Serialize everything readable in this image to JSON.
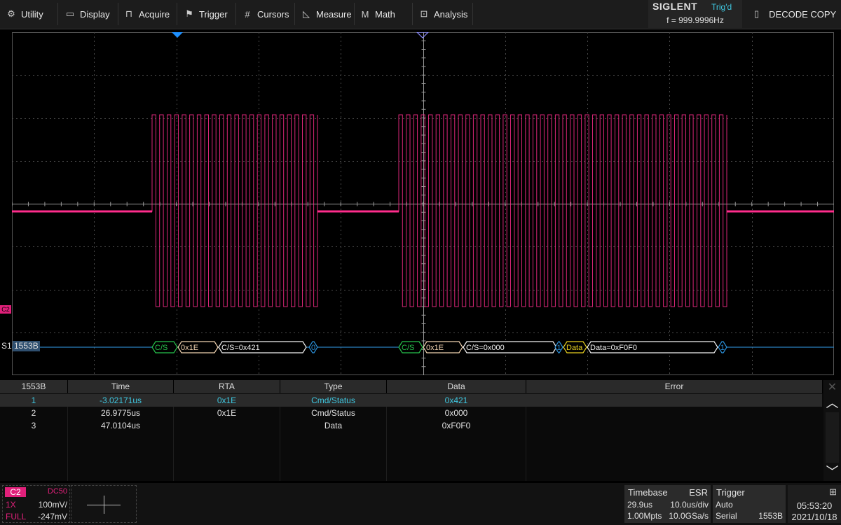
{
  "menu": {
    "items": [
      {
        "label": "Utility",
        "icon": "gear-icon"
      },
      {
        "label": "Display",
        "icon": "monitor-icon"
      },
      {
        "label": "Acquire",
        "icon": "acquire-icon"
      },
      {
        "label": "Trigger",
        "icon": "flag-icon"
      },
      {
        "label": "Cursors",
        "icon": "cursor-icon"
      },
      {
        "label": "Measure",
        "icon": "ruler-icon"
      },
      {
        "label": "Math",
        "icon": "math-icon"
      },
      {
        "label": "Analysis",
        "icon": "analysis-icon"
      }
    ]
  },
  "status": {
    "brand": "SIGLENT",
    "trigger_state": "Trig'd",
    "frequency": "f = 999.9996Hz"
  },
  "decode_copy": {
    "label": "DECODE COPY",
    "icon": "copy-icon"
  },
  "waveform": {
    "channel_marker": "C2",
    "trace_color": "#ff2d8c",
    "bus_label": "S1",
    "bus_protocol": "1553B",
    "decode_segments": [
      {
        "label": "C/S",
        "kind": "sync"
      },
      {
        "label": "0x1E",
        "kind": "rta"
      },
      {
        "label": "C/S=0x421",
        "kind": "word"
      },
      {
        "label": "0",
        "kind": "parity"
      },
      {
        "label": "C/S",
        "kind": "sync"
      },
      {
        "label": "0x1E",
        "kind": "rta"
      },
      {
        "label": "C/S=0x000",
        "kind": "word"
      },
      {
        "label": "1",
        "kind": "parity"
      },
      {
        "label": "Data",
        "kind": "datasync"
      },
      {
        "label": "Data=0xF0F0",
        "kind": "word"
      },
      {
        "label": "1",
        "kind": "parity"
      }
    ]
  },
  "decode_table": {
    "headers": [
      "1553B",
      "Time",
      "RTA",
      "Type",
      "Data",
      "Error"
    ],
    "rows": [
      {
        "index": "1",
        "time": "-3.02171us",
        "rta": "0x1E",
        "type": "Cmd/Status",
        "data": "0x421",
        "error": "",
        "selected": true
      },
      {
        "index": "2",
        "time": "26.9775us",
        "rta": "0x1E",
        "type": "Cmd/Status",
        "data": "0x000",
        "error": "",
        "selected": false
      },
      {
        "index": "3",
        "time": "47.0104us",
        "rta": "",
        "type": "Data",
        "data": "0xF0F0",
        "error": "",
        "selected": false
      }
    ]
  },
  "channel": {
    "name": "C2",
    "coupling": "DC50",
    "probe": "1X",
    "scale": "100mV/",
    "bandwidth": "FULL",
    "offset": "-247mV",
    "color": "#e0207a"
  },
  "timebase": {
    "title": "Timebase",
    "mode": "ESR",
    "delay": "29.9us",
    "scale": "10.0us/div",
    "memory": "1.00Mpts",
    "sample_rate": "10.0GSa/s"
  },
  "trigger": {
    "title": "Trigger",
    "mode": "Auto",
    "type": "Serial",
    "source": "1553B"
  },
  "clock": {
    "time": "05:53:20",
    "date": "2021/10/18",
    "icon": "network-icon"
  }
}
